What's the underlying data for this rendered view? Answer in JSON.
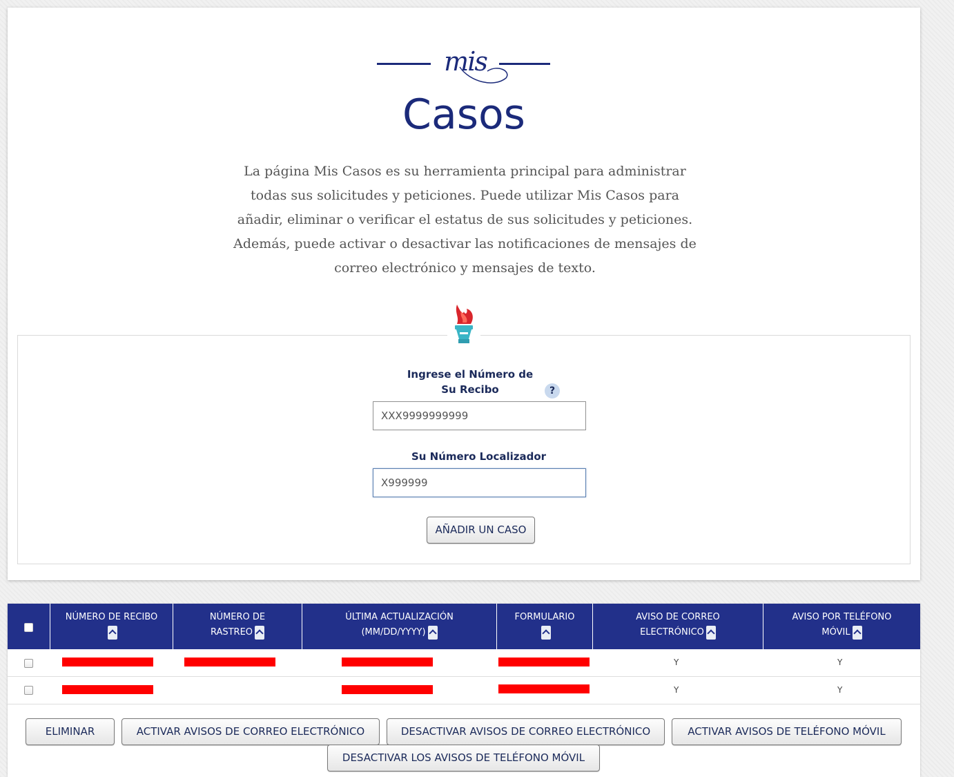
{
  "header": {
    "logo_script": "mis",
    "title": "Casos",
    "intro": "La página Mis Casos es su herramienta principal para administrar todas sus solicitudes y peticiones. Puede utilizar Mis Casos para añadir, eliminar o verificar el estatus de sus solicitudes y peticiones. Además, puede activar o desactivar las notificaciones de mensajes de correo electrónico y mensajes de texto."
  },
  "form": {
    "receipt_label": "Ingrese el Número de Su Recibo",
    "help": "?",
    "receipt_value": "XXX9999999999",
    "locator_label": "Su Número Localizador",
    "locator_value": "X999999",
    "add_button": "AÑADIR UN CASO"
  },
  "table": {
    "columns": [
      "NÚMERO DE RECIBO",
      "NÚMERO DE RASTREO",
      "ÚLTIMA ACTUALIZACIÓN (MM/DD/YYYY)",
      "FORMULARIO",
      "AVISO DE CORREO ELECTRÓNICO",
      "AVISO POR TELÉFONO MÓVIL"
    ],
    "rows": [
      {
        "email_notice": "Y",
        "mobile_notice": "Y"
      },
      {
        "email_notice": "Y",
        "mobile_notice": "Y"
      }
    ]
  },
  "actions": {
    "delete": "ELIMINAR",
    "activate_email": "ACTIVAR AVISOS DE CORREO ELECTRÓNICO",
    "deactivate_email": "DESACTIVAR AVISOS DE CORREO ELECTRÓNICO",
    "activate_mobile": "ACTIVAR AVISOS DE TELÉFONO MÓVIL",
    "deactivate_mobile": "DESACTIVAR LOS AVISOS DE TELÉFONO MÓVIL"
  },
  "colors": {
    "brand_navy": "#1b2a7a",
    "table_header": "#22308a",
    "redaction": "#ff0000",
    "torch_flame": "#d9262c",
    "torch_base": "#3ab5c6"
  },
  "icons": [
    "mis-logo",
    "torch-icon",
    "help-icon",
    "sort-up-icon"
  ]
}
